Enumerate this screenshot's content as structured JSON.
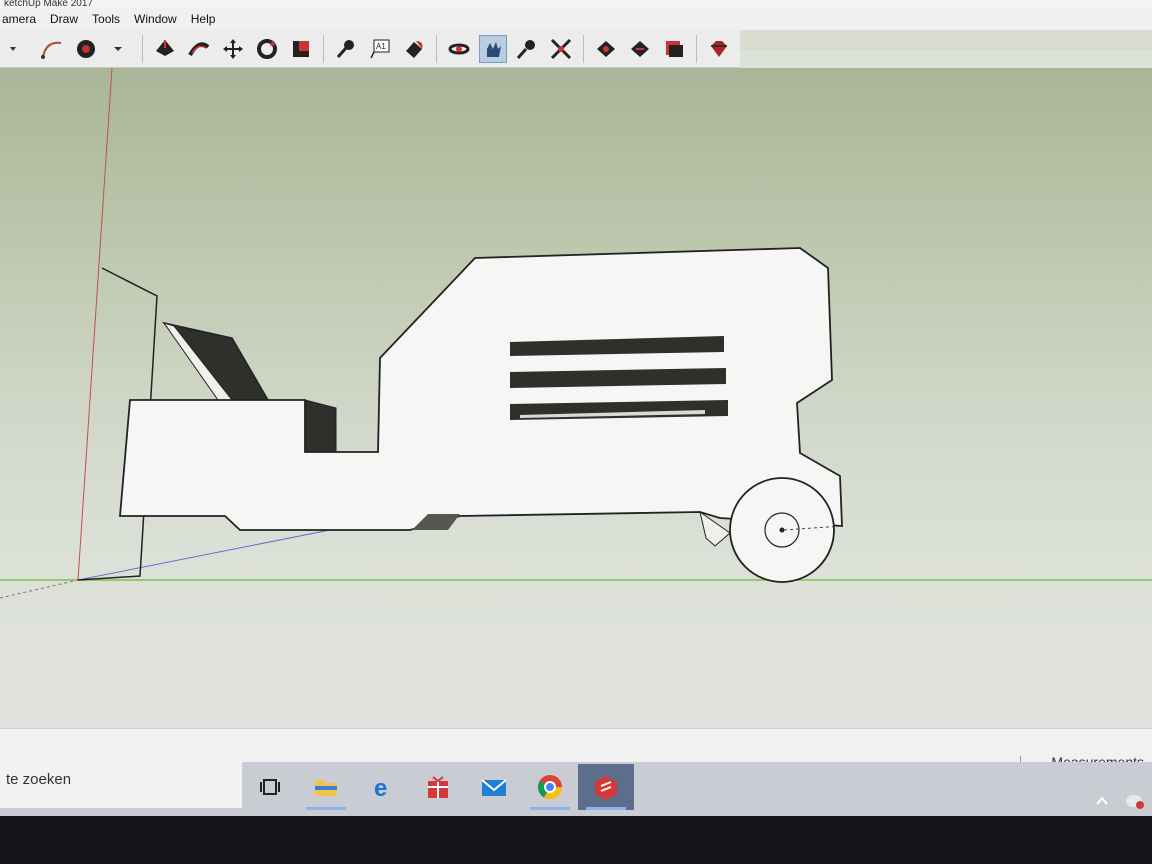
{
  "window": {
    "title": "ketchUp Make 2017"
  },
  "menu": {
    "items": [
      "amera",
      "Draw",
      "Tools",
      "Window",
      "Help"
    ]
  },
  "toolbar": {
    "icons": [
      "arc-icon",
      "arc-dropdown-icon",
      "paint-bucket-icon",
      "paint-dropdown-icon",
      "push-pull-icon",
      "follow-me-icon",
      "move-icon",
      "rotate-icon",
      "scale-icon",
      "tape-measure-icon",
      "text-icon",
      "paint-icon",
      "orbit-icon",
      "pan-icon",
      "zoom-icon",
      "zoom-extents-icon",
      "warehouse-icon",
      "component-icon",
      "extension-icon",
      "ruby-icon"
    ],
    "active": "pan-icon"
  },
  "statusbar": {
    "measurements_label": "Measurements"
  },
  "taskbar": {
    "search_placeholder": "te zoeken",
    "apps": [
      "task-view-icon",
      "file-explorer-icon",
      "edge-icon",
      "store-icon",
      "mail-icon",
      "chrome-icon",
      "sketchup-icon"
    ],
    "active_app": "sketchup-icon"
  },
  "colors": {
    "viewport_sky_top": "#a9b598",
    "viewport_ground": "#e1e4de",
    "model_face": "#f7f6f4",
    "model_dark": "#2e302c",
    "axis_green": "#7fbf4a",
    "axis_red": "#c0504d",
    "axis_blue": "#6a6ad0",
    "taskbar": "#c9ccd3"
  }
}
